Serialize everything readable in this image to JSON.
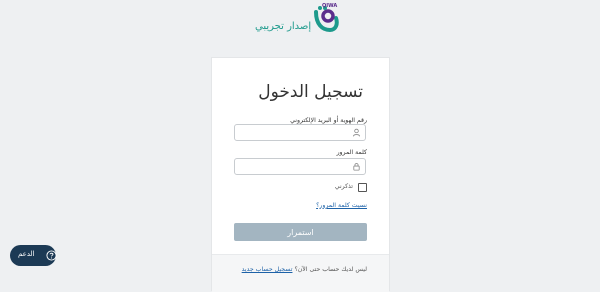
{
  "header": {
    "logo_badge": "QIWA",
    "logo_subtitle": "إصدار تجريبي"
  },
  "login": {
    "title": "تسجيل الدخول",
    "id_label": "رقم الهوية أو البريد الإلكتروني",
    "id_value": "",
    "password_label": "كلمة المرور",
    "password_value": "",
    "remember_label": "تذكرني",
    "remember_checked": false,
    "forgot_link": "نسيت كلمة المرور؟",
    "submit_label": "استمرار"
  },
  "footer": {
    "no_account_text": "ليس لديك حساب حتى الآن؟",
    "register_link": "تسجيل حساب جديد"
  },
  "support": {
    "label": "الدعم"
  },
  "icons": {
    "logo": "qiwa-logo-icon",
    "user": "user-icon",
    "lock": "lock-icon",
    "support": "chat-help-icon"
  },
  "colors": {
    "brand_teal": "#1d9a8c",
    "brand_purple": "#5a2d8c",
    "link": "#1d62a8",
    "button_disabled": "#a3b5c1",
    "support_bg": "#1c3a55"
  }
}
